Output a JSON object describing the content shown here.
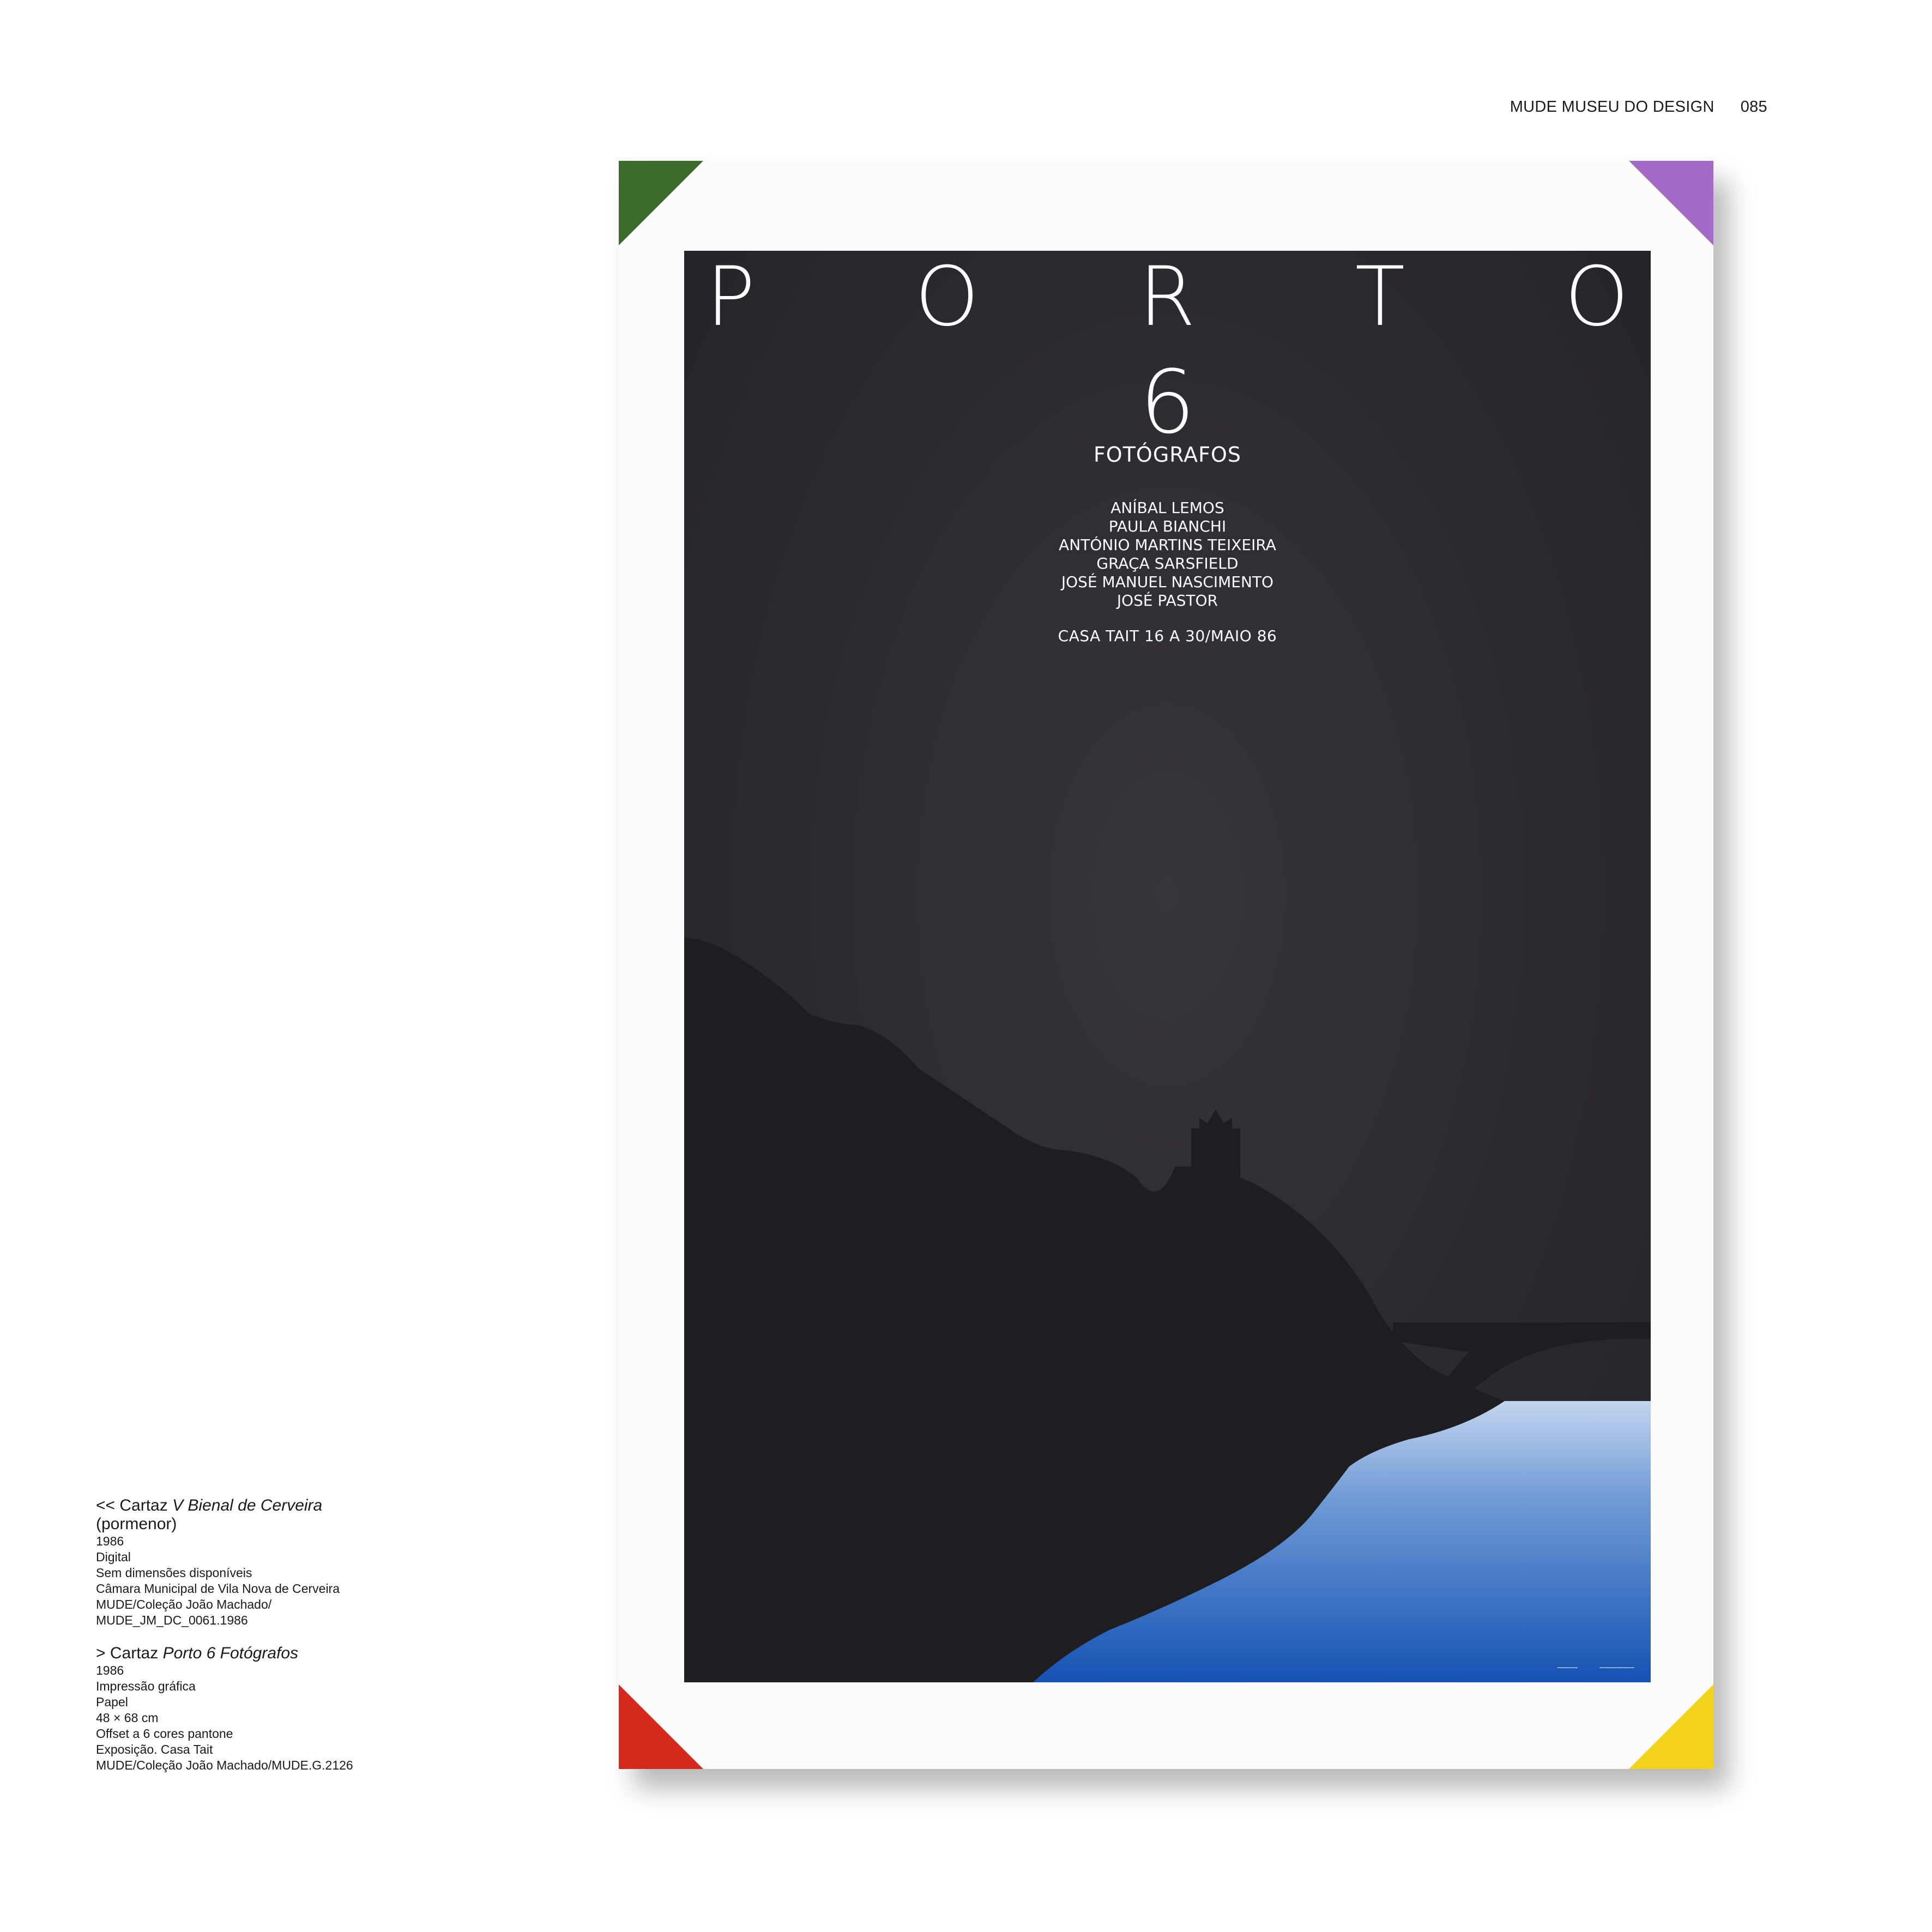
{
  "header": {
    "publication": "MUDE MUSEU DO DESIGN",
    "page_number": "085"
  },
  "poster": {
    "title_letters": [
      "P",
      "O",
      "R",
      "T",
      "O"
    ],
    "number": "6",
    "subtitle": "FOTÓGRAFOS",
    "photographers": [
      "ANÍBAL LEMOS",
      "PAULA BIANCHI",
      "ANTÓNIO MARTINS TEIXEIRA",
      "GRAÇA SARSFIELD",
      "JOSÉ MANUEL NASCIMENTO",
      "JOSÉ PASTOR"
    ],
    "venue_dates": "CASA TAIT 16 A 30/MAIO 86",
    "corner_colors": {
      "top_left": "#3d6b2a",
      "top_right": "#a36bc7",
      "bottom_left": "#d42a1e",
      "bottom_right": "#f2d21a"
    },
    "art_colors": {
      "sky": "#2b2a2e",
      "hill": "#1e1d20",
      "water_top": "#b9cde9",
      "water_bottom": "#1452b3"
    }
  },
  "captions": [
    {
      "prefix": "<< Cartaz ",
      "title_italic": "V Bienal de Cerveira",
      "title_suffix": "(pormenor)",
      "lines": [
        "1986",
        "Digital",
        "Sem dimensões disponíveis",
        "Câmara Municipal de Vila Nova de Cerveira",
        "MUDE/Coleção João Machado/",
        "MUDE_JM_DC_0061.1986"
      ]
    },
    {
      "prefix": "> Cartaz ",
      "title_italic": "Porto 6 Fotógrafos",
      "title_suffix": "",
      "lines": [
        "1986",
        "Impressão gráfica",
        "Papel",
        "48 × 68 cm",
        "Offset a 6 cores pantone",
        "Exposição. Casa Tait",
        "MUDE/Coleção João Machado/MUDE.G.2126"
      ]
    }
  ]
}
